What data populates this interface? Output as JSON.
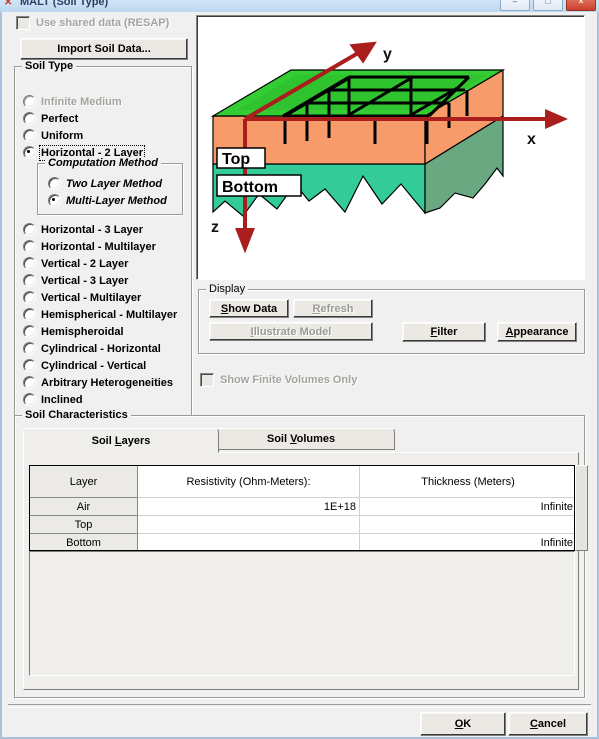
{
  "window": {
    "title": "MALT (Soil Type)",
    "app_icon": "malt-icon",
    "minimize": "–",
    "maximize": "□",
    "close": "✕"
  },
  "shared_data": {
    "checkbox_label": "Use shared data (RESAP)",
    "checked": false,
    "enabled": false
  },
  "import_button": {
    "label": "Import Soil Data..."
  },
  "soil_type": {
    "group_label": "Soil Type",
    "options": [
      {
        "label": "Infinite Medium",
        "selected": false,
        "enabled": false
      },
      {
        "label": "Perfect",
        "selected": false,
        "enabled": true
      },
      {
        "label": "Uniform",
        "selected": false,
        "enabled": true
      },
      {
        "label": "Horizontal - 2 Layer",
        "selected": true,
        "enabled": true,
        "focused": true
      },
      {
        "label": "Horizontal - 3 Layer",
        "selected": false,
        "enabled": true
      },
      {
        "label": "Horizontal - Multilayer",
        "selected": false,
        "enabled": true
      },
      {
        "label": "Vertical - 2 Layer",
        "selected": false,
        "enabled": true
      },
      {
        "label": "Vertical - 3 Layer",
        "selected": false,
        "enabled": true
      },
      {
        "label": "Vertical - Multilayer",
        "selected": false,
        "enabled": true
      },
      {
        "label": "Hemispherical - Multilayer",
        "selected": false,
        "enabled": true
      },
      {
        "label": "Hemispheroidal",
        "selected": false,
        "enabled": true
      },
      {
        "label": "Cylindrical - Horizontal",
        "selected": false,
        "enabled": true
      },
      {
        "label": "Cylindrical - Vertical",
        "selected": false,
        "enabled": true
      },
      {
        "label": "Arbitrary Heterogeneities",
        "selected": false,
        "enabled": true
      },
      {
        "label": "Inclined",
        "selected": false,
        "enabled": true
      }
    ]
  },
  "computation_method": {
    "group_label": "Computation Method",
    "options": [
      {
        "label": "Two Layer Method",
        "selected": false
      },
      {
        "label": "Multi-Layer Method",
        "selected": true
      }
    ]
  },
  "illustration": {
    "label_top": "Top",
    "label_bottom": "Bottom",
    "axis_x": "x",
    "axis_y": "y",
    "axis_z": "z",
    "colors": {
      "surface_green": "#33cc33",
      "top_layer": "#f79b6b",
      "bottom_layer": "#33cc99",
      "side_shade": "#6aa882",
      "axis_red": "#aa1e1e",
      "grid_black": "#000000"
    }
  },
  "display": {
    "group_label": "Display",
    "buttons": [
      {
        "label": "Show Data",
        "mnemonic": "S",
        "enabled": true
      },
      {
        "label": "Refresh",
        "mnemonic": "R",
        "enabled": false
      },
      {
        "label": "Illustrate Model",
        "mnemonic": "I",
        "enabled": false
      },
      {
        "label": "Filter",
        "mnemonic": "F",
        "enabled": true
      },
      {
        "label": "Appearance",
        "mnemonic": "A",
        "enabled": true
      }
    ],
    "finite_volumes_checkbox": {
      "label": "Show Finite Volumes Only",
      "checked": false,
      "enabled": false
    }
  },
  "soil_characteristics": {
    "group_label": "Soil Characteristics",
    "tabs": [
      {
        "label": "Soil Layers",
        "mnemonic": "L",
        "selected": true
      },
      {
        "label": "Soil Volumes",
        "mnemonic": "V",
        "selected": false
      }
    ],
    "table": {
      "columns": [
        "Layer",
        "Resistivity (Ohm-Meters):",
        "Thickness (Meters)"
      ],
      "rows": [
        {
          "layer": "Air",
          "resistivity": "1E+18",
          "thickness": "Infinite"
        },
        {
          "layer": "Top",
          "resistivity": "",
          "thickness": ""
        },
        {
          "layer": "Bottom",
          "resistivity": "",
          "thickness": "Infinite"
        }
      ]
    }
  },
  "footer": {
    "ok": "OK",
    "ok_mnemonic": "O",
    "cancel": "Cancel",
    "cancel_mnemonic": "C"
  }
}
